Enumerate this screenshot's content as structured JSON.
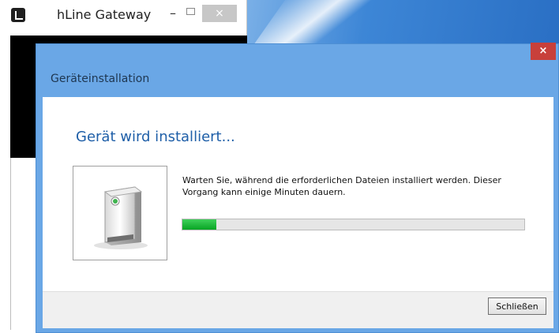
{
  "background_window": {
    "title": "hLine Gateway",
    "minimize_symbol": "–",
    "close_symbol": "×"
  },
  "dialog": {
    "title": "Geräteinstallation",
    "close_symbol": "×",
    "heading": "Gerät wird installiert...",
    "message": "Warten Sie, während die erforderlichen Dateien installiert werden. Dieser Vorgang kann einige Minuten dauern.",
    "progress_fraction": 0.1,
    "close_button_label": "Schließen"
  },
  "colors": {
    "dialog_frame": "#6aa7e6",
    "heading": "#1f5fa8",
    "progress_fill": "#08a524",
    "close_button_red": "#c8403b"
  },
  "icons": [
    "app-icon",
    "device-icon"
  ]
}
